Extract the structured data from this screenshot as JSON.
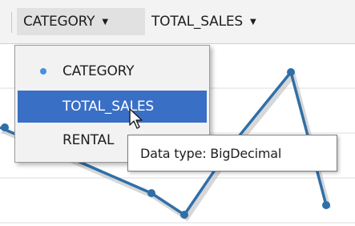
{
  "toolbar": {
    "category_label": "CATEGORY",
    "sales_label": "TOTAL_SALES",
    "caret": "▼"
  },
  "menu": {
    "items": [
      {
        "label": "CATEGORY",
        "checked": true
      },
      {
        "label": "TOTAL_SALES",
        "selected": true
      },
      {
        "label": "RENTAL",
        "truncated": true
      }
    ]
  },
  "tooltip": {
    "text": "Data type: BigDecimal"
  },
  "colors": {
    "accent": "#3a6fc6",
    "line": "#2f6fa8",
    "bullet": "#4a90d9"
  }
}
